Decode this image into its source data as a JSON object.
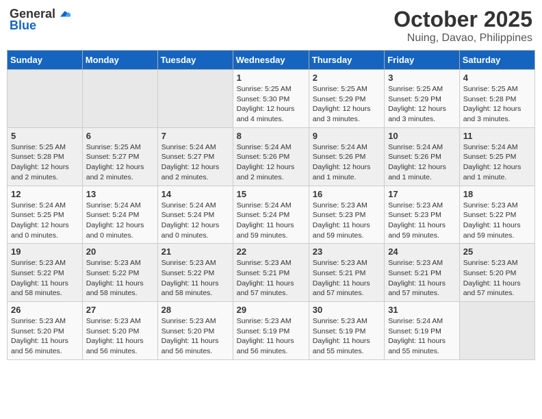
{
  "logo": {
    "general": "General",
    "blue": "Blue"
  },
  "title": "October 2025",
  "location": "Nuing, Davao, Philippines",
  "weekdays": [
    "Sunday",
    "Monday",
    "Tuesday",
    "Wednesday",
    "Thursday",
    "Friday",
    "Saturday"
  ],
  "weeks": [
    [
      {
        "day": "",
        "sunrise": "",
        "sunset": "",
        "daylight": "",
        "empty": true
      },
      {
        "day": "",
        "sunrise": "",
        "sunset": "",
        "daylight": "",
        "empty": true
      },
      {
        "day": "",
        "sunrise": "",
        "sunset": "",
        "daylight": "",
        "empty": true
      },
      {
        "day": "1",
        "sunrise": "Sunrise: 5:25 AM",
        "sunset": "Sunset: 5:30 PM",
        "daylight": "Daylight: 12 hours and 4 minutes."
      },
      {
        "day": "2",
        "sunrise": "Sunrise: 5:25 AM",
        "sunset": "Sunset: 5:29 PM",
        "daylight": "Daylight: 12 hours and 3 minutes."
      },
      {
        "day": "3",
        "sunrise": "Sunrise: 5:25 AM",
        "sunset": "Sunset: 5:29 PM",
        "daylight": "Daylight: 12 hours and 3 minutes."
      },
      {
        "day": "4",
        "sunrise": "Sunrise: 5:25 AM",
        "sunset": "Sunset: 5:28 PM",
        "daylight": "Daylight: 12 hours and 3 minutes."
      }
    ],
    [
      {
        "day": "5",
        "sunrise": "Sunrise: 5:25 AM",
        "sunset": "Sunset: 5:28 PM",
        "daylight": "Daylight: 12 hours and 2 minutes."
      },
      {
        "day": "6",
        "sunrise": "Sunrise: 5:25 AM",
        "sunset": "Sunset: 5:27 PM",
        "daylight": "Daylight: 12 hours and 2 minutes."
      },
      {
        "day": "7",
        "sunrise": "Sunrise: 5:24 AM",
        "sunset": "Sunset: 5:27 PM",
        "daylight": "Daylight: 12 hours and 2 minutes."
      },
      {
        "day": "8",
        "sunrise": "Sunrise: 5:24 AM",
        "sunset": "Sunset: 5:26 PM",
        "daylight": "Daylight: 12 hours and 2 minutes."
      },
      {
        "day": "9",
        "sunrise": "Sunrise: 5:24 AM",
        "sunset": "Sunset: 5:26 PM",
        "daylight": "Daylight: 12 hours and 1 minute."
      },
      {
        "day": "10",
        "sunrise": "Sunrise: 5:24 AM",
        "sunset": "Sunset: 5:26 PM",
        "daylight": "Daylight: 12 hours and 1 minute."
      },
      {
        "day": "11",
        "sunrise": "Sunrise: 5:24 AM",
        "sunset": "Sunset: 5:25 PM",
        "daylight": "Daylight: 12 hours and 1 minute."
      }
    ],
    [
      {
        "day": "12",
        "sunrise": "Sunrise: 5:24 AM",
        "sunset": "Sunset: 5:25 PM",
        "daylight": "Daylight: 12 hours and 0 minutes."
      },
      {
        "day": "13",
        "sunrise": "Sunrise: 5:24 AM",
        "sunset": "Sunset: 5:24 PM",
        "daylight": "Daylight: 12 hours and 0 minutes."
      },
      {
        "day": "14",
        "sunrise": "Sunrise: 5:24 AM",
        "sunset": "Sunset: 5:24 PM",
        "daylight": "Daylight: 12 hours and 0 minutes."
      },
      {
        "day": "15",
        "sunrise": "Sunrise: 5:24 AM",
        "sunset": "Sunset: 5:24 PM",
        "daylight": "Daylight: 11 hours and 59 minutes."
      },
      {
        "day": "16",
        "sunrise": "Sunrise: 5:23 AM",
        "sunset": "Sunset: 5:23 PM",
        "daylight": "Daylight: 11 hours and 59 minutes."
      },
      {
        "day": "17",
        "sunrise": "Sunrise: 5:23 AM",
        "sunset": "Sunset: 5:23 PM",
        "daylight": "Daylight: 11 hours and 59 minutes."
      },
      {
        "day": "18",
        "sunrise": "Sunrise: 5:23 AM",
        "sunset": "Sunset: 5:22 PM",
        "daylight": "Daylight: 11 hours and 59 minutes."
      }
    ],
    [
      {
        "day": "19",
        "sunrise": "Sunrise: 5:23 AM",
        "sunset": "Sunset: 5:22 PM",
        "daylight": "Daylight: 11 hours and 58 minutes."
      },
      {
        "day": "20",
        "sunrise": "Sunrise: 5:23 AM",
        "sunset": "Sunset: 5:22 PM",
        "daylight": "Daylight: 11 hours and 58 minutes."
      },
      {
        "day": "21",
        "sunrise": "Sunrise: 5:23 AM",
        "sunset": "Sunset: 5:22 PM",
        "daylight": "Daylight: 11 hours and 58 minutes."
      },
      {
        "day": "22",
        "sunrise": "Sunrise: 5:23 AM",
        "sunset": "Sunset: 5:21 PM",
        "daylight": "Daylight: 11 hours and 57 minutes."
      },
      {
        "day": "23",
        "sunrise": "Sunrise: 5:23 AM",
        "sunset": "Sunset: 5:21 PM",
        "daylight": "Daylight: 11 hours and 57 minutes."
      },
      {
        "day": "24",
        "sunrise": "Sunrise: 5:23 AM",
        "sunset": "Sunset: 5:21 PM",
        "daylight": "Daylight: 11 hours and 57 minutes."
      },
      {
        "day": "25",
        "sunrise": "Sunrise: 5:23 AM",
        "sunset": "Sunset: 5:20 PM",
        "daylight": "Daylight: 11 hours and 57 minutes."
      }
    ],
    [
      {
        "day": "26",
        "sunrise": "Sunrise: 5:23 AM",
        "sunset": "Sunset: 5:20 PM",
        "daylight": "Daylight: 11 hours and 56 minutes."
      },
      {
        "day": "27",
        "sunrise": "Sunrise: 5:23 AM",
        "sunset": "Sunset: 5:20 PM",
        "daylight": "Daylight: 11 hours and 56 minutes."
      },
      {
        "day": "28",
        "sunrise": "Sunrise: 5:23 AM",
        "sunset": "Sunset: 5:20 PM",
        "daylight": "Daylight: 11 hours and 56 minutes."
      },
      {
        "day": "29",
        "sunrise": "Sunrise: 5:23 AM",
        "sunset": "Sunset: 5:19 PM",
        "daylight": "Daylight: 11 hours and 56 minutes."
      },
      {
        "day": "30",
        "sunrise": "Sunrise: 5:23 AM",
        "sunset": "Sunset: 5:19 PM",
        "daylight": "Daylight: 11 hours and 55 minutes."
      },
      {
        "day": "31",
        "sunrise": "Sunrise: 5:24 AM",
        "sunset": "Sunset: 5:19 PM",
        "daylight": "Daylight: 11 hours and 55 minutes."
      },
      {
        "day": "",
        "sunrise": "",
        "sunset": "",
        "daylight": "",
        "empty": true
      }
    ]
  ]
}
